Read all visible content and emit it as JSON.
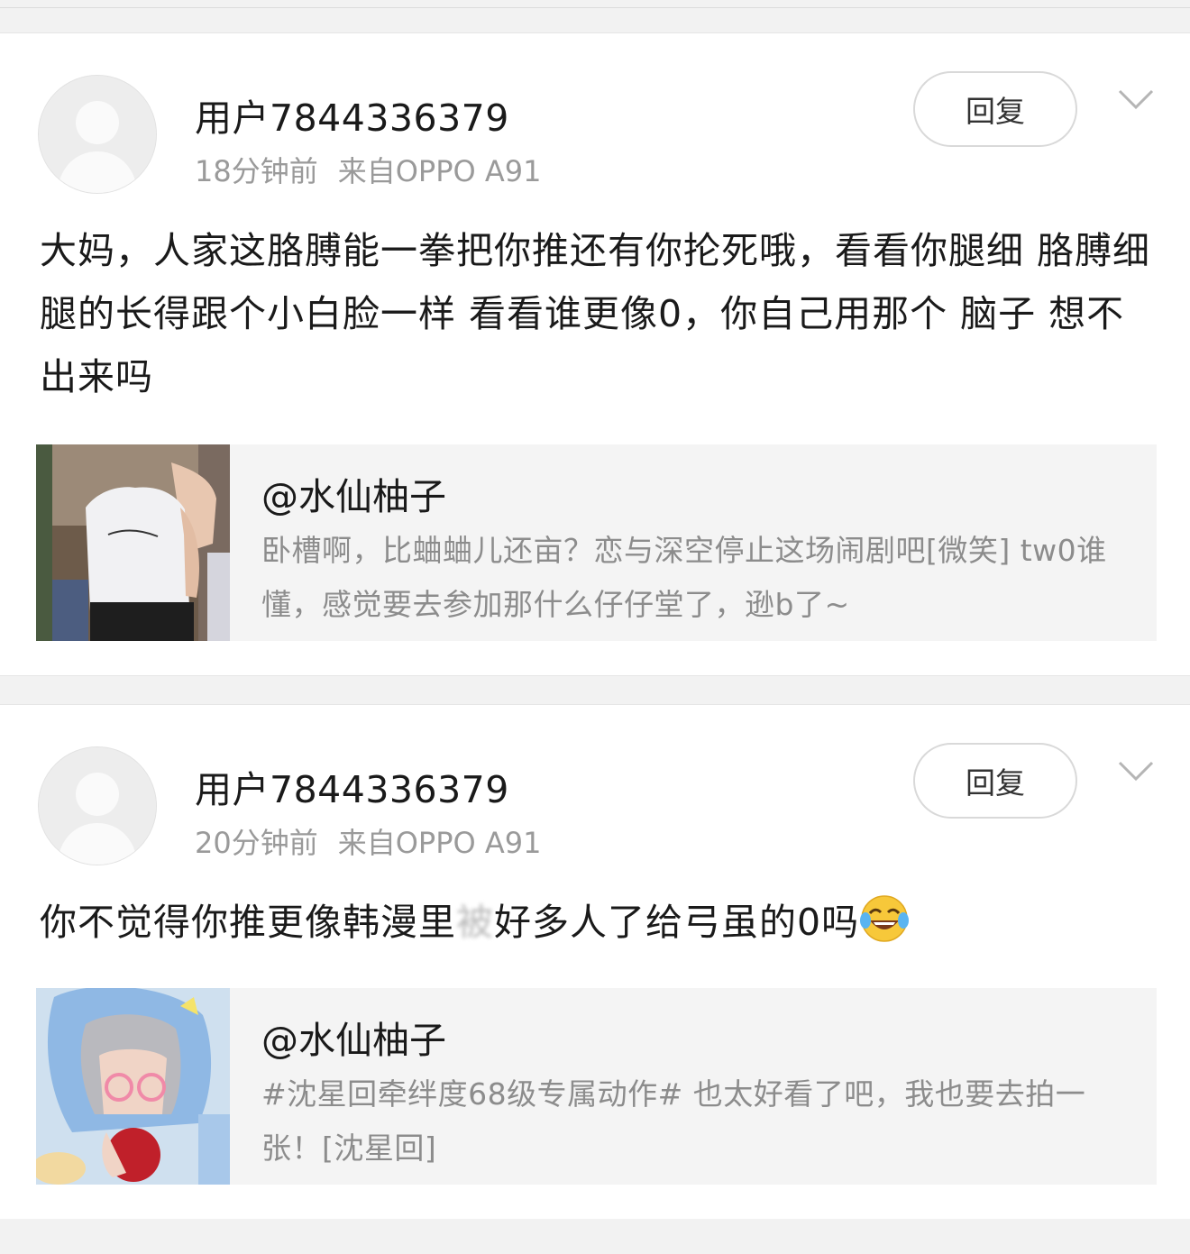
{
  "colors": {
    "accent_text": "#1a1a1a",
    "muted_text": "#9a9a9a",
    "quote_bg": "#f4f4f4",
    "page_bg": "#f2f2f2"
  },
  "comments": [
    {
      "username": "用户7844336379",
      "time": "18分钟前",
      "source": "来自OPPO A91",
      "reply_label": "回复",
      "body": "大妈，人家这胳膊能一拳把你推还有你抡死哦，看看你腿细 胳膊细腿的长得跟个小白脸一样 看看谁更像0，你自己用那个 脑子 想不出来吗",
      "quote": {
        "name": "@水仙柚子",
        "text": "卧槽啊，比蛐蛐儿还亩？恋与深空停止这场闹剧吧[微笑] tw0谁懂，感觉要去参加那什么仔仔堂了，逊b了~",
        "thumb_icon": "character-photo-icon"
      }
    },
    {
      "username": "用户7844336379",
      "time": "20分钟前",
      "source": "来自OPPO A91",
      "reply_label": "回复",
      "body_before": "你不觉得你推更像韩漫里",
      "body_blurred": "被",
      "body_after": "好多人了给弓虽的0吗",
      "body_emoji": "laughing-tears-emoji",
      "quote": {
        "name": "@水仙柚子",
        "text": "#沈星回牵绊度68级专属动作# 也太好看了吧，我也要去拍一张！[沈星回]",
        "thumb_icon": "character-photo-icon"
      }
    }
  ]
}
